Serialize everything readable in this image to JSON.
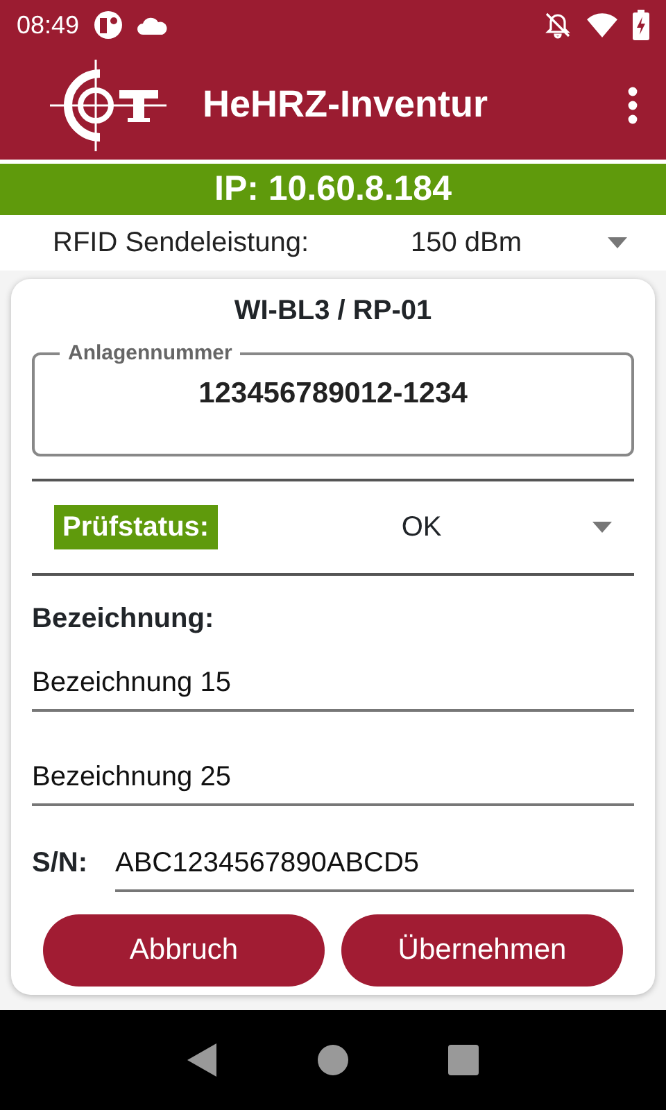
{
  "status_bar": {
    "time": "08:49"
  },
  "app_bar": {
    "title": "HeHRZ-Inventur"
  },
  "connection": {
    "text": "IP: 10.60.8.184",
    "connected": true
  },
  "rfid": {
    "label": "RFID Sendeleistung:",
    "value": "150 dBm"
  },
  "card": {
    "title": "WI-BL3 / RP-01",
    "asset_number": {
      "label": "Anlagennummer",
      "value": "123456789012-1234"
    },
    "check_status": {
      "label": "Prüfstatus:",
      "value": "OK",
      "color": "#5f9a0c"
    },
    "description_label": "Bezeichnung:",
    "descriptions": [
      "Bezeichnung 15",
      "Bezeichnung 25"
    ],
    "serial": {
      "label": "S/N:",
      "value": "ABC1234567890ABCD5"
    },
    "buttons": [
      "Abbruch",
      "Übernehmen"
    ]
  }
}
